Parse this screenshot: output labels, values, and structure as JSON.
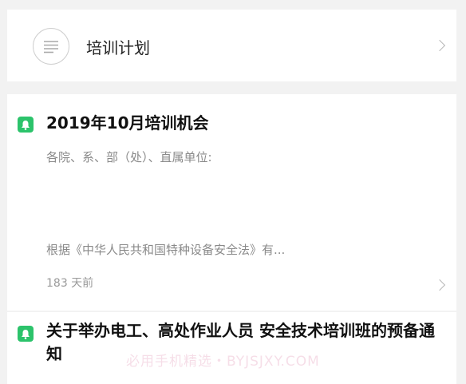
{
  "plan": {
    "title": "培训计划",
    "icon": "list-icon",
    "chevron": "chevron-right-icon"
  },
  "notices": [
    {
      "icon": "bell-icon",
      "title": "2019年10月培训机会",
      "greeting": "各院、系、部（处）、直属单位:",
      "excerpt": "根据《中华人民共和国特种设备安全法》有...",
      "time": "183 天前"
    },
    {
      "icon": "bell-icon",
      "title": "关于举办电工、高处作业人员 安全技术培训班的预备通知"
    }
  ],
  "watermark": "必用手机精选・BYJSJXY.COM",
  "colors": {
    "accent": "#2cc36b",
    "background": "#f2f2f2",
    "card": "#ffffff"
  }
}
